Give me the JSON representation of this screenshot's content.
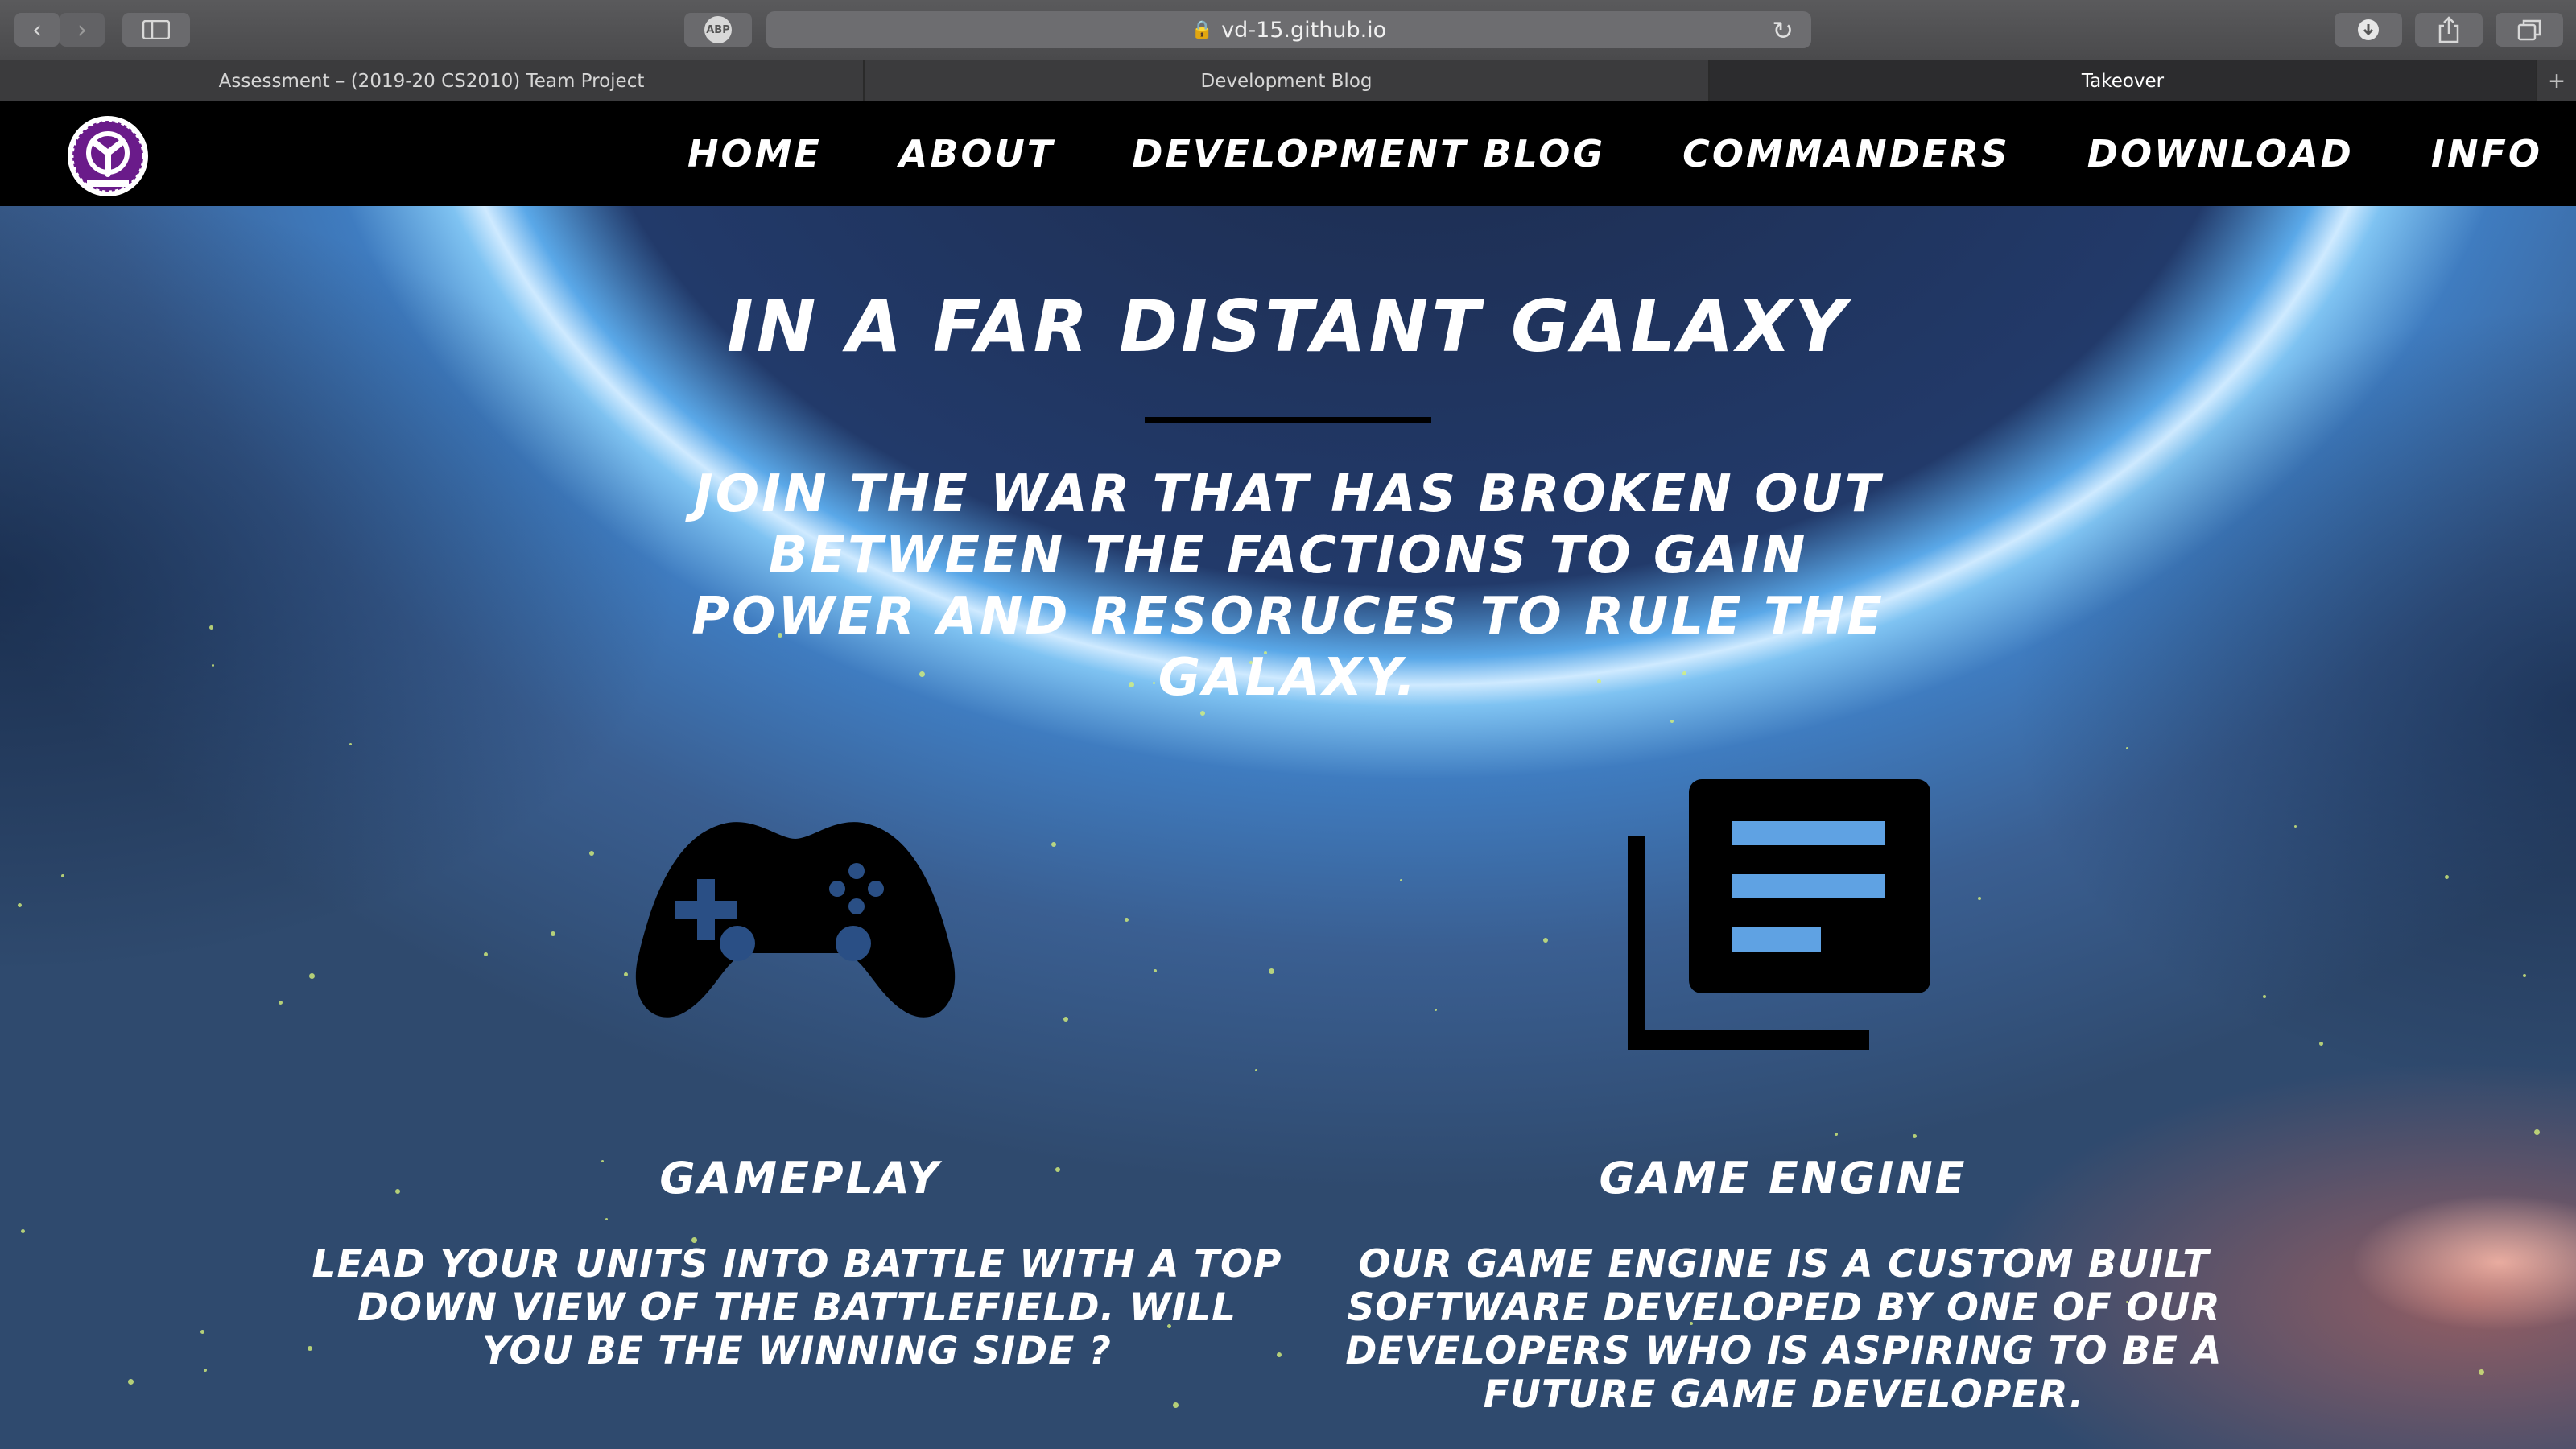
{
  "browser": {
    "url": "vd-15.github.io",
    "adblock_label": "ABP",
    "tabs": [
      {
        "label": "Assessment – (2019-20 CS2010) Team Project"
      },
      {
        "label": "Development Blog"
      },
      {
        "label": "Takeover"
      }
    ],
    "new_tab_label": "+",
    "icons": [
      "back-icon",
      "forward-icon",
      "sidebar-icon",
      "adblock-icon",
      "lock-icon",
      "reload-icon",
      "download-icon",
      "share-icon",
      "tabs-overview-icon"
    ]
  },
  "nav": {
    "items": [
      {
        "label": "HOME"
      },
      {
        "label": "ABOUT"
      },
      {
        "label": "DEVELOPMENT BLOG"
      },
      {
        "label": "COMMANDERS"
      },
      {
        "label": "DOWNLOAD"
      },
      {
        "label": "INFO"
      }
    ]
  },
  "hero": {
    "title": "IN A FAR DISTANT GALAXY",
    "lead": "JOIN THE WAR THAT HAS BROKEN OUT BETWEEN THE FACTIONS TO GAIN POWER AND RESORUCES TO RULE THE GALAXY."
  },
  "features": [
    {
      "icon": "gamepad-icon",
      "title": "GAMEPLAY",
      "text": "LEAD YOUR UNITS INTO BATTLE WITH A TOP DOWN VIEW OF THE BATTLEFIELD. WILL YOU BE THE WINNING SIDE ?"
    },
    {
      "icon": "news-library-icon",
      "title": "GAME ENGINE",
      "text": "OUR GAME ENGINE IS A CUSTOM BUILT SOFTWARE DEVELOPED BY ONE OF OUR DEVELOPERS WHO IS ASPIRING TO BE A FUTURE GAME DEVELOPER."
    }
  ],
  "colors": {
    "nav_bg": "#000000",
    "text": "#ffffff",
    "logo_accent": "#6a1b8a",
    "planet_glow": "#cfeaff"
  }
}
